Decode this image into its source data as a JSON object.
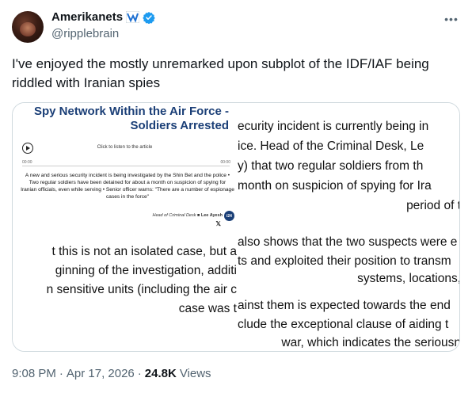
{
  "author": {
    "display_name": "Amerikanets",
    "handle": "@ripplebrain",
    "flag_icon": "flag-icon",
    "verified_icon": "verified-badge-icon",
    "verified_color": "#1d9bf0"
  },
  "more_label": "•••",
  "tweet_text": "I've enjoyed the mostly unremarked upon subplot of the IDF/IAF being riddled with Iranian spies",
  "media": {
    "article": {
      "title": "Spy Network Within the Air Force - Soldiers Arrested",
      "listen_label": "Click to listen to the article",
      "time_start": "00:00",
      "time_end": "00:00",
      "summary": "A new and serious security incident is being investigated by the Shin Bet and the police • Two regular soldiers have been detained for about a month on suspicion of spying for Iranian officials, even while serving • Senior officer warns: \"There are a number of espionage cases in the force\"",
      "byline_prefix": "Head of Criminal Desk",
      "byline_name": "Lee Ayesh",
      "logo": "i24",
      "x_icon": "𝕏"
    },
    "zoom_top_right": [
      "ecurity incident is currently being in",
      "ice. Head of the Criminal Desk, Le",
      "y) that two regular soldiers from th",
      "month on suspicion of spying for Ira",
      "period of t"
    ],
    "zoom_bottom_left": [
      "t this is not an isolated case, but a",
      "ginning of the investigation, additi",
      "n sensitive units (including the air c",
      "case was t"
    ],
    "zoom_bottom_right": [
      "also shows that the two suspects were e",
      "ts and exploited their position to transm",
      "systems, locations,",
      "ainst them is expected towards the end",
      "clude the exceptional clause of aiding t",
      "war, which indicates the seriousn"
    ]
  },
  "footer": {
    "time": "9:08 PM",
    "separator1": "·",
    "date": "Apr 17, 2026",
    "separator2": "·",
    "views_count": "24.8K",
    "views_label": "Views"
  }
}
